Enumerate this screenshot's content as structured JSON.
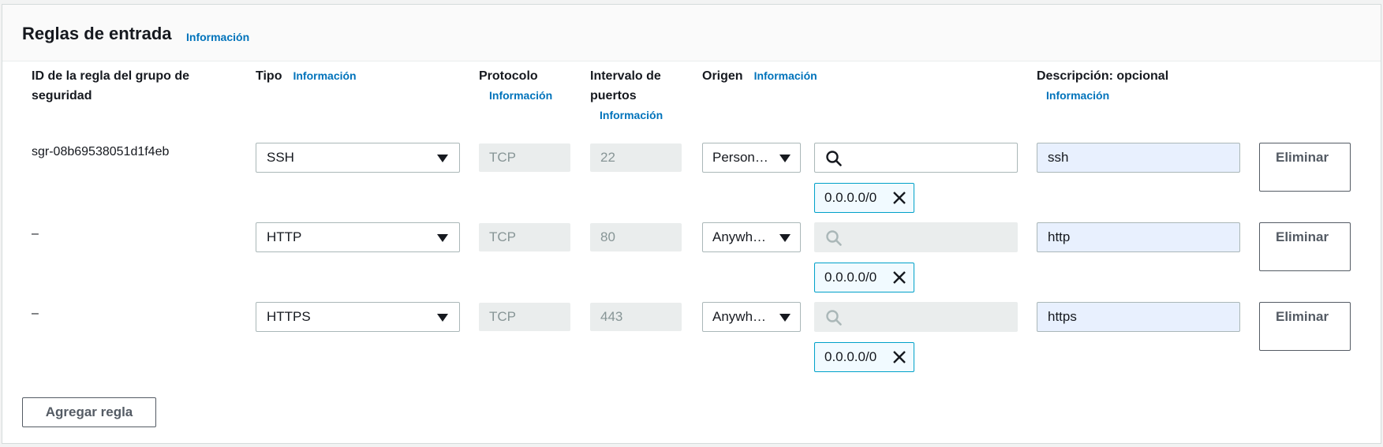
{
  "panel": {
    "title": "Reglas de entrada",
    "info": "Información"
  },
  "columns": {
    "rule_id": "ID de la regla del grupo de seguridad",
    "type": "Tipo",
    "type_info": "Información",
    "protocol": "Protocolo",
    "protocol_info": "Información",
    "port_range": "Intervalo de puertos",
    "port_info": "Información",
    "source": "Origen",
    "source_info": "Información",
    "description": "Descripción: opcional",
    "description_info": "Información"
  },
  "rules": [
    {
      "id": "sgr-08b69538051d1f4eb",
      "type": "SSH",
      "protocol": "TCP",
      "port": "22",
      "source_type": "Person…",
      "cidr": "0.0.0.0/0",
      "description": "ssh",
      "delete_label": "Eliminar"
    },
    {
      "id": "–",
      "type": "HTTP",
      "protocol": "TCP",
      "port": "80",
      "source_type": "Anywh…",
      "cidr": "0.0.0.0/0",
      "description": "http",
      "delete_label": "Eliminar"
    },
    {
      "id": "–",
      "type": "HTTPS",
      "protocol": "TCP",
      "port": "443",
      "source_type": "Anywh…",
      "cidr": "0.0.0.0/0",
      "description": "https",
      "delete_label": "Eliminar"
    }
  ],
  "add_rule_label": "Agregar regla",
  "colors": {
    "link": "#0073bb",
    "token_border": "#00a1c9",
    "desc_bg": "#e8f0fe"
  }
}
